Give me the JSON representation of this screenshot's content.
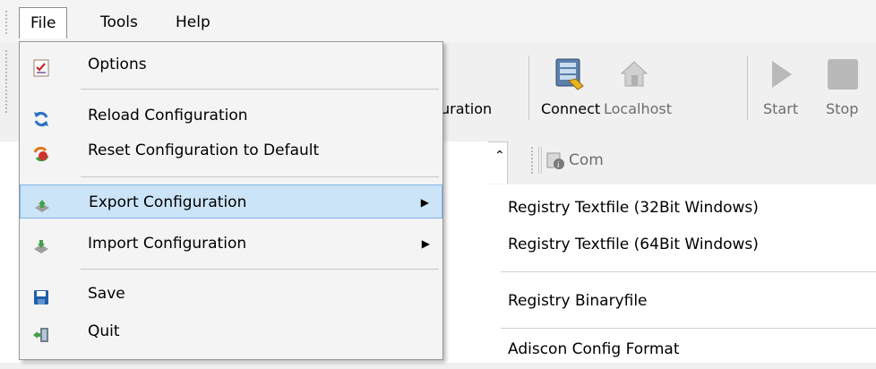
{
  "menubar": {
    "file": "File",
    "tools": "Tools",
    "help": "Help"
  },
  "toolbar": {
    "config_fragment": "uration",
    "connect": "Connect",
    "localhost": "Localhost",
    "start": "Start",
    "stop": "Stop",
    "commands_fragment": "Com"
  },
  "file_menu": {
    "options": "Options",
    "reload": "Reload Configuration",
    "reset": "Reset Configuration to Default",
    "export": "Export Configuration",
    "import": "Import Configuration",
    "save": "Save",
    "quit": "Quit",
    "submenu_arrow": "▶"
  },
  "export_submenu": {
    "reg32": "Registry Textfile (32Bit Windows)",
    "reg64": "Registry Textfile (64Bit Windows)",
    "binary": "Registry Binaryfile",
    "adiscon": "Adiscon Config Format"
  },
  "icons": {
    "options": "checklist-icon",
    "reload": "refresh-icon",
    "reset": "reset-icon",
    "export": "export-icon",
    "import": "import-icon",
    "save": "floppy-disk-icon",
    "quit": "exit-door-icon"
  },
  "colors": {
    "highlight": "#cce4f7",
    "highlight_border": "#7eb4ea"
  }
}
